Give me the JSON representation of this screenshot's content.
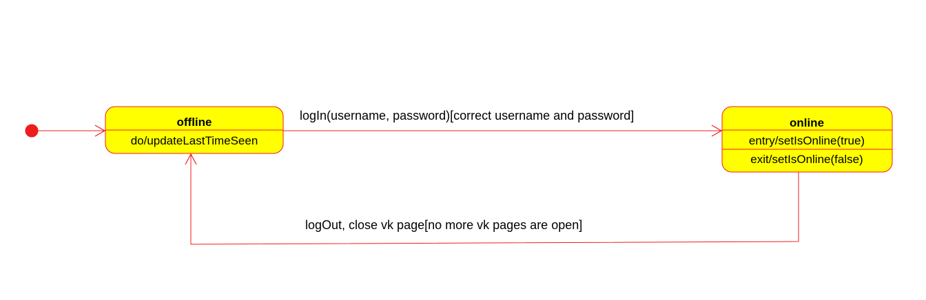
{
  "diagram": {
    "type": "uml-state-diagram",
    "line_color": "#ee1c1c",
    "state_fill": "#ffff00",
    "initial_node_color": "#ee1c1c",
    "states": {
      "offline": {
        "name": "offline",
        "activities": [
          "do/updateLastTimeSeen"
        ]
      },
      "online": {
        "name": "online",
        "activities": [
          "entry/setIsOnline(true)",
          "exit/setIsOnline(false)"
        ]
      }
    },
    "transitions": {
      "initial_to_offline": {
        "label": ""
      },
      "login": {
        "label": "logIn(username, password)[correct username and password]"
      },
      "logout": {
        "label": "logOut, close vk page[no more vk pages are open]"
      }
    }
  }
}
